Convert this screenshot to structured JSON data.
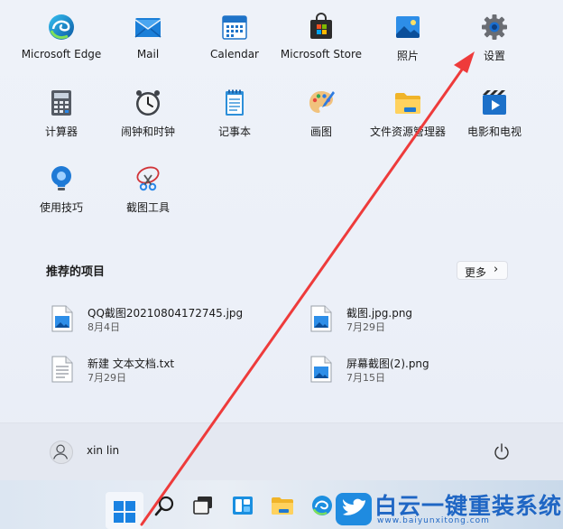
{
  "apps": [
    {
      "id": "edge",
      "label": "Microsoft Edge",
      "icon": "edge-icon"
    },
    {
      "id": "mail",
      "label": "Mail",
      "icon": "mail-icon"
    },
    {
      "id": "calendar",
      "label": "Calendar",
      "icon": "calendar-icon"
    },
    {
      "id": "store",
      "label": "Microsoft Store",
      "icon": "store-icon"
    },
    {
      "id": "photos",
      "label": "照片",
      "icon": "photos-icon"
    },
    {
      "id": "settings",
      "label": "设置",
      "icon": "gear-icon"
    },
    {
      "id": "calculator",
      "label": "计算器",
      "icon": "calculator-icon"
    },
    {
      "id": "clock",
      "label": "闹钟和时钟",
      "icon": "clock-icon"
    },
    {
      "id": "notepad",
      "label": "记事本",
      "icon": "notepad-icon"
    },
    {
      "id": "paint",
      "label": "画图",
      "icon": "paint-icon"
    },
    {
      "id": "explorer",
      "label": "文件资源管理器",
      "icon": "folder-icon"
    },
    {
      "id": "movies",
      "label": "电影和电视",
      "icon": "movies-icon"
    },
    {
      "id": "tips",
      "label": "使用技巧",
      "icon": "tips-icon"
    },
    {
      "id": "snip",
      "label": "截图工具",
      "icon": "snipping-tool-icon"
    }
  ],
  "recommended": {
    "title": "推荐的项目",
    "more_label": "更多",
    "items": [
      {
        "name": "QQ截图20210804172745.jpg",
        "date": "8月4日",
        "icon": "image-file-icon"
      },
      {
        "name": "截图.jpg.png",
        "date": "7月29日",
        "icon": "image-file-icon"
      },
      {
        "name": "新建 文本文档.txt",
        "date": "7月29日",
        "icon": "text-file-icon"
      },
      {
        "name": "屏幕截图(2).png",
        "date": "7月15日",
        "icon": "image-file-icon"
      }
    ]
  },
  "user": {
    "name": "xin lin"
  },
  "watermark": {
    "text": "白云一键重装系统",
    "url": "www.baiyunxitong.com"
  },
  "colors": {
    "accent": "#0067c0",
    "arrow": "#ee3b3b",
    "watermark": "#1f66c4"
  }
}
